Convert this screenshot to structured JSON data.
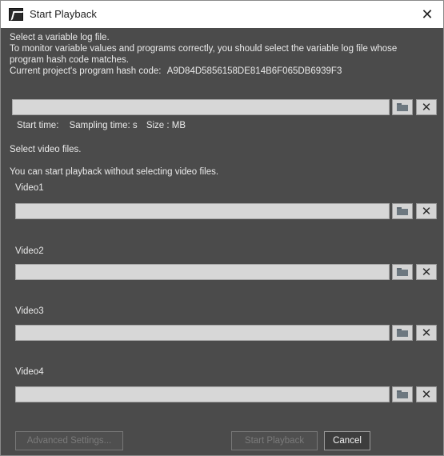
{
  "window": {
    "title": "Start Playback",
    "close_glyph": "✕"
  },
  "log_section": {
    "line1": "Select a variable log file.",
    "line2": "To monitor variable values and programs correctly, you should select the variable log file whose",
    "line3": "program hash code matches.",
    "hash_label": "Current project's program hash code:",
    "hash_value": "A9D84D5856158DE814B6F065DB6939F3",
    "file_value": "",
    "info": {
      "start_time": "Start time:",
      "sampling_time": "Sampling time: s",
      "size": "Size : MB"
    }
  },
  "video_section": {
    "title": "Select video files.",
    "note": "You can start playback without selecting video files.",
    "videos": [
      {
        "label": "Video1",
        "value": ""
      },
      {
        "label": "Video2",
        "value": ""
      },
      {
        "label": "Video3",
        "value": ""
      },
      {
        "label": "Video4",
        "value": ""
      }
    ]
  },
  "icons": {
    "browse": "folder-icon",
    "clear": "clear-x-icon",
    "clear_glyph": "✕"
  },
  "footer": {
    "advanced_settings": "Advanced Settings...",
    "start_playback": "Start Playback",
    "cancel": "Cancel"
  }
}
